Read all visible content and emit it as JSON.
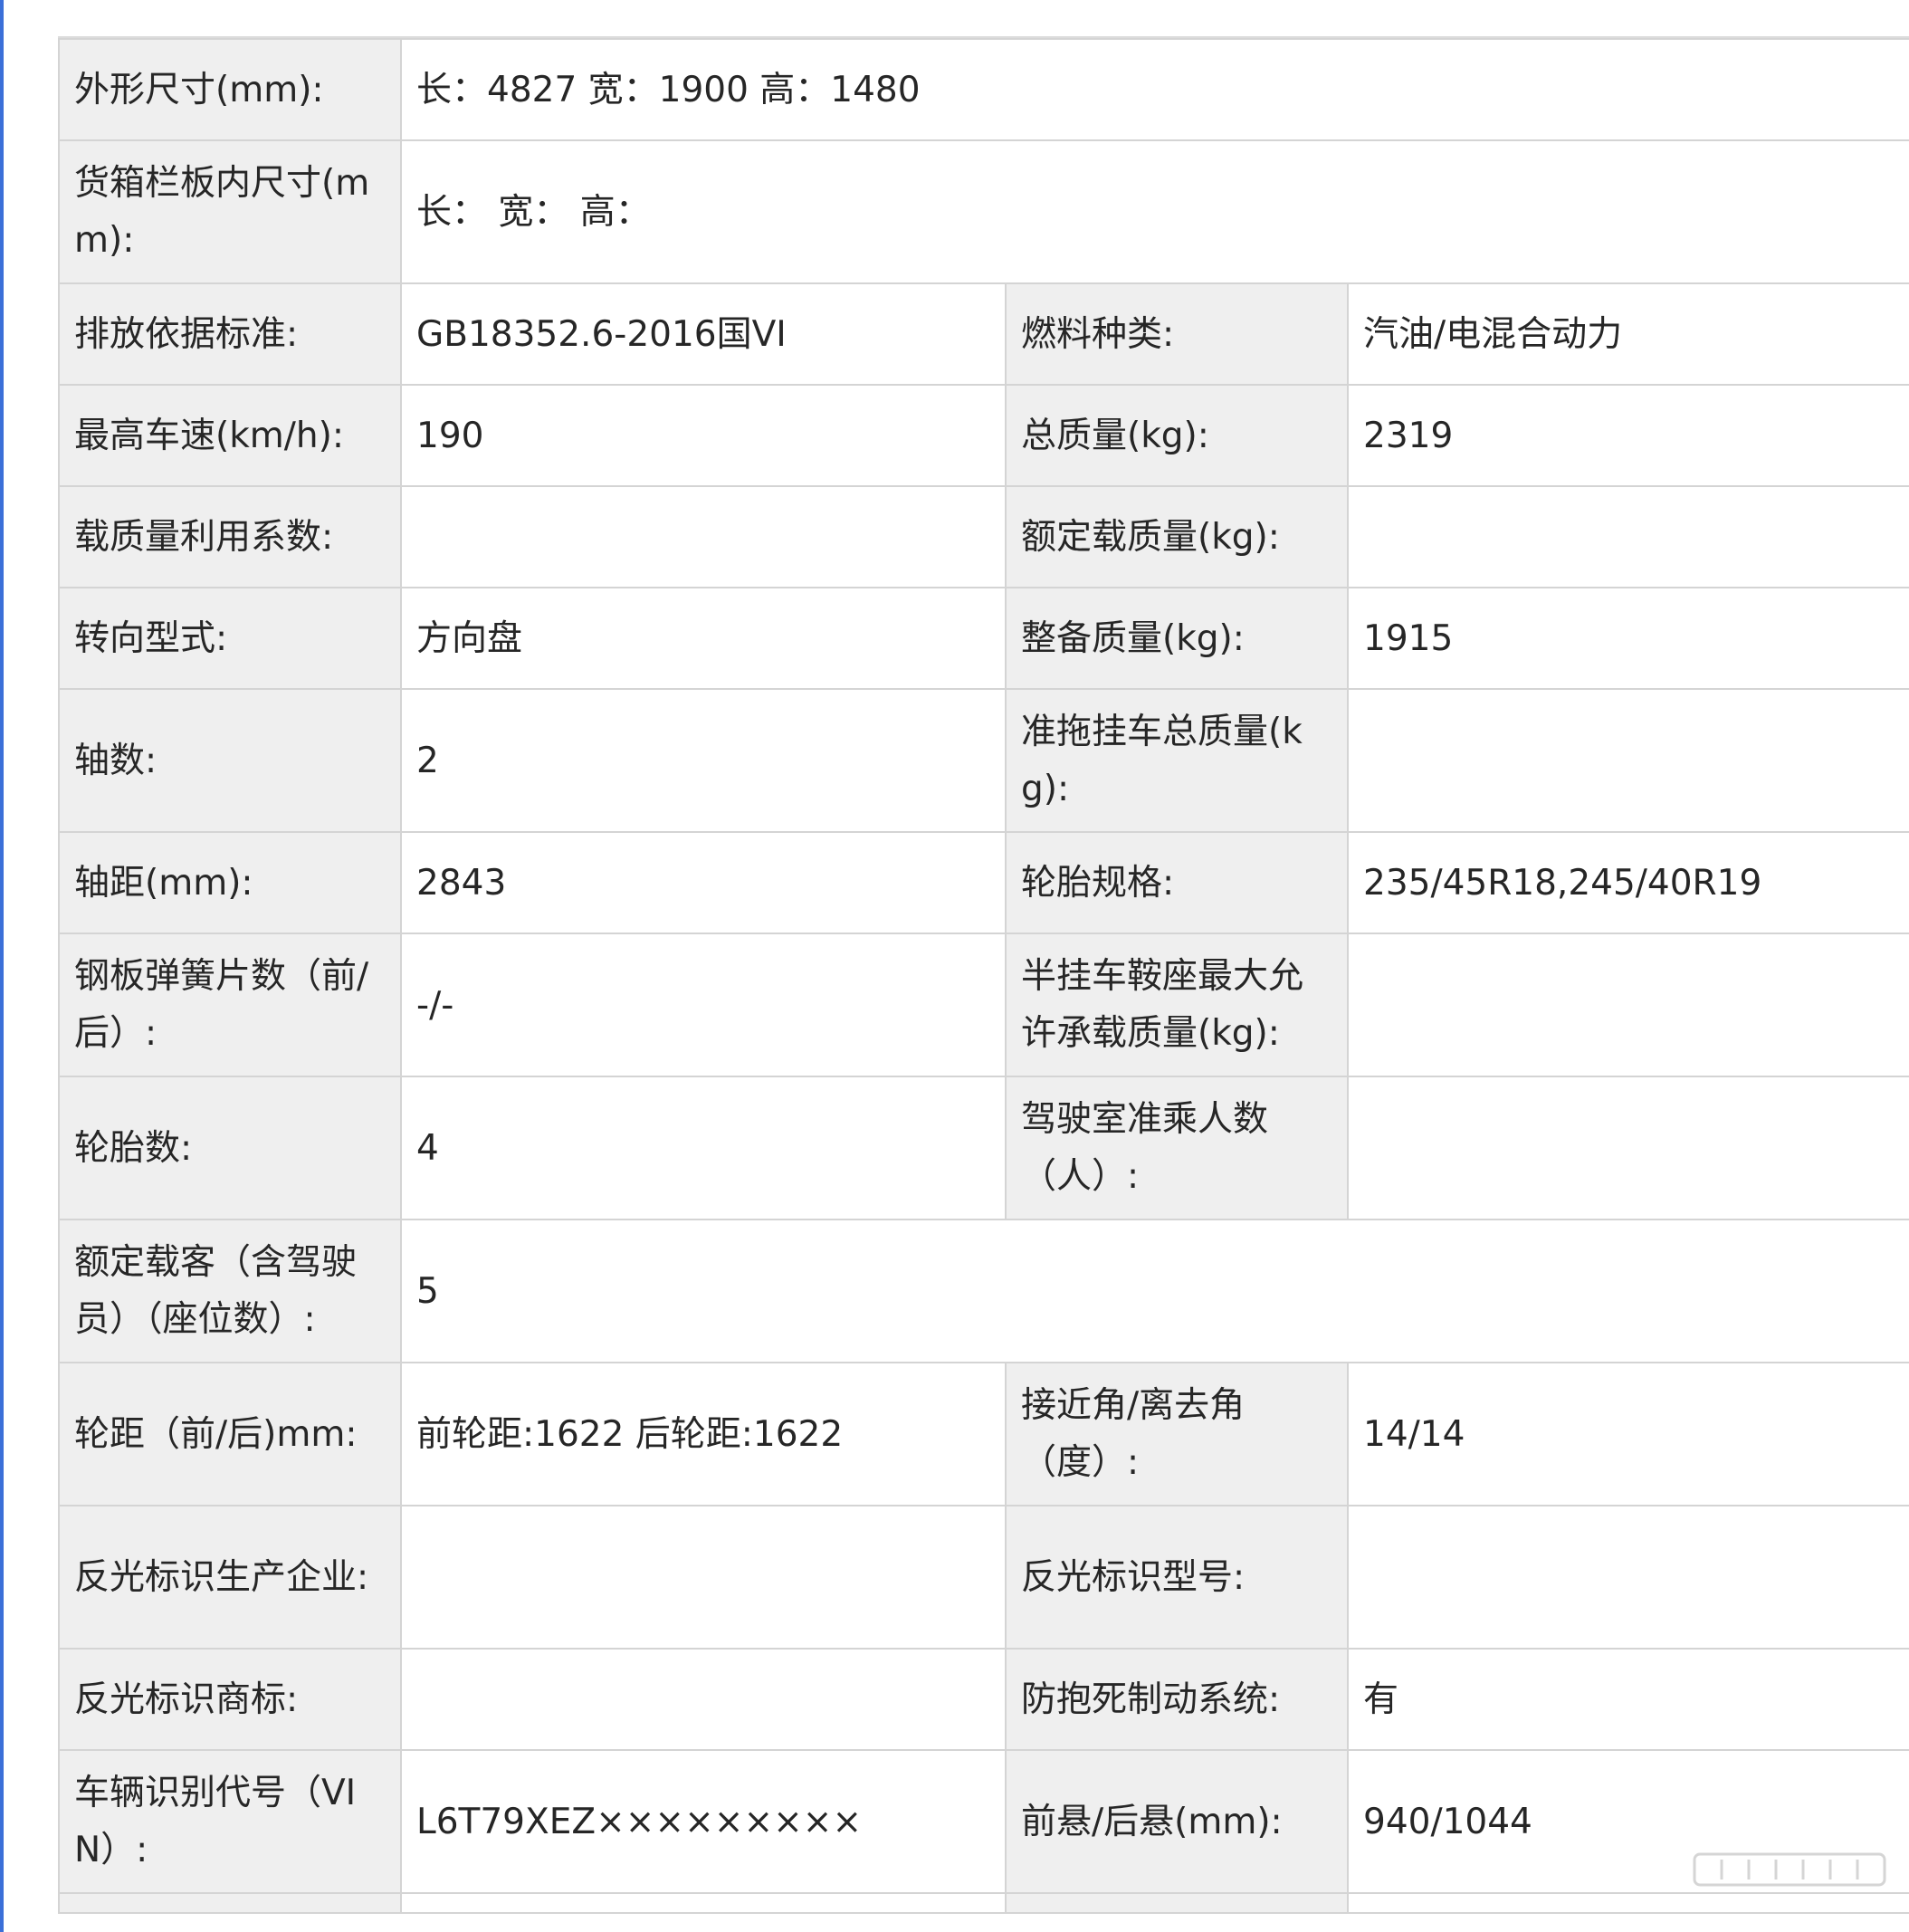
{
  "rows": [
    {
      "l1": "外形尺寸(mm):",
      "v1": "长：4827 宽：1900 高：1480"
    },
    {
      "l1": "货箱栏板内尺寸(mm):",
      "v1": "长：  宽：  高："
    },
    {
      "l1": "排放依据标准:",
      "v1": "GB18352.6-2016国VI",
      "l2": "燃料种类:",
      "v2": "汽油/电混合动力"
    },
    {
      "l1": "最高车速(km/h):",
      "v1": "190",
      "l2": "总质量(kg):",
      "v2": "2319"
    },
    {
      "l1": "载质量利用系数:",
      "v1": "",
      "l2": "额定载质量(kg):",
      "v2": ""
    },
    {
      "l1": "转向型式:",
      "v1": "方向盘",
      "l2": "整备质量(kg):",
      "v2": "1915"
    },
    {
      "l1": "轴数:",
      "v1": "2",
      "l2": "准拖挂车总质量(kg):",
      "v2": ""
    },
    {
      "l1": "轴距(mm):",
      "v1": "2843",
      "l2": "轮胎规格:",
      "v2": "235/45R18,245/40R19"
    },
    {
      "l1": "钢板弹簧片数（前/后）:",
      "v1": "-/-",
      "l2": "半挂车鞍座最大允许承载质量(kg):",
      "v2": ""
    },
    {
      "l1": "轮胎数:",
      "v1": "4",
      "l2": "驾驶室准乘人数（人）:",
      "v2": ""
    },
    {
      "l1": "额定载客（含驾驶员）（座位数）:",
      "v1": "5"
    },
    {
      "l1": "轮距（前/后)mm:",
      "v1": "前轮距:1622 后轮距:1622",
      "l2": "接近角/离去角（度）:",
      "v2": "14/14"
    },
    {
      "l1": "反光标识生产企业:",
      "v1": "",
      "l2": "反光标识型号:",
      "v2": ""
    },
    {
      "l1": "反光标识商标:",
      "v1": "",
      "l2": "防抱死制动系统:",
      "v2": "有"
    },
    {
      "l1": "车辆识别代号（VIN）:",
      "v1": "L6T79XEZ×××××××××",
      "l2": "前悬/后悬(mm):",
      "v2": "940/1044"
    }
  ],
  "colors": {
    "label_bg": "#efefef",
    "border": "#d4d4d4",
    "accent_bar": "#3b6fd8"
  }
}
